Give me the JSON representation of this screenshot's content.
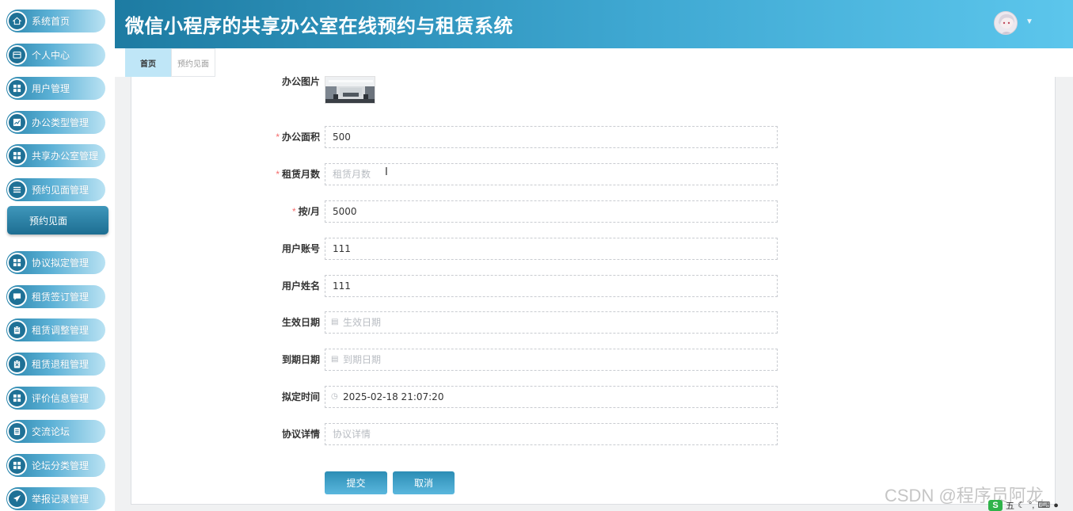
{
  "header": {
    "title": "微信小程序的共享办公室在线预约与租赁系统"
  },
  "sidebar": {
    "items": [
      {
        "label": "系统首页",
        "icon": "home-icon"
      },
      {
        "label": "个人中心",
        "icon": "card-icon"
      },
      {
        "label": "用户管理",
        "icon": "grid-icon"
      },
      {
        "label": "办公类型管理",
        "icon": "chart-icon"
      },
      {
        "label": "共享办公室管理",
        "icon": "grid-icon"
      },
      {
        "label": "预约见面管理",
        "icon": "list-icon"
      },
      {
        "label": "协议拟定管理",
        "icon": "grid-icon"
      },
      {
        "label": "租赁签订管理",
        "icon": "chat-icon"
      },
      {
        "label": "租赁调整管理",
        "icon": "clipboard-icon"
      },
      {
        "label": "租赁退租管理",
        "icon": "clipboard-x-icon"
      },
      {
        "label": "评价信息管理",
        "icon": "grid-icon"
      },
      {
        "label": "交流论坛",
        "icon": "doc-icon"
      },
      {
        "label": "论坛分类管理",
        "icon": "grid-icon"
      },
      {
        "label": "举报记录管理",
        "icon": "send-icon"
      }
    ],
    "submenu_active": "预约见面"
  },
  "tabs": [
    {
      "label": "首页",
      "active": true
    },
    {
      "label": "预约见面",
      "active": false
    }
  ],
  "form": {
    "image_label": "办公图片",
    "fields": [
      {
        "label": "办公面积",
        "required": true,
        "value": "500",
        "placeholder": ""
      },
      {
        "label": "租赁月数",
        "required": true,
        "value": "",
        "placeholder": "租赁月数"
      },
      {
        "label": "按/月",
        "required": true,
        "value": "5000",
        "placeholder": ""
      },
      {
        "label": "用户账号",
        "required": false,
        "value": "111",
        "placeholder": ""
      },
      {
        "label": "用户姓名",
        "required": false,
        "value": "111",
        "placeholder": ""
      },
      {
        "label": "生效日期",
        "required": false,
        "value": "",
        "placeholder": "生效日期",
        "icon": "calendar-icon"
      },
      {
        "label": "到期日期",
        "required": false,
        "value": "",
        "placeholder": "到期日期",
        "icon": "calendar-icon"
      },
      {
        "label": "拟定时间",
        "required": false,
        "value": "2025-02-18 21:07:20",
        "placeholder": "",
        "icon": "clock-icon"
      },
      {
        "label": "协议详情",
        "required": false,
        "value": "",
        "placeholder": "协议详情"
      }
    ],
    "required_mark": "*",
    "submit_label": "提交",
    "cancel_label": "取消"
  },
  "watermark": "CSDN @程序员阿龙",
  "tray": {
    "ime": "S",
    "text": "五"
  },
  "colors": {
    "accent": "#2b86ad",
    "header_end": "#5cc6ec",
    "active_tab": "#bfe6f7",
    "required": "#f56c6c"
  }
}
